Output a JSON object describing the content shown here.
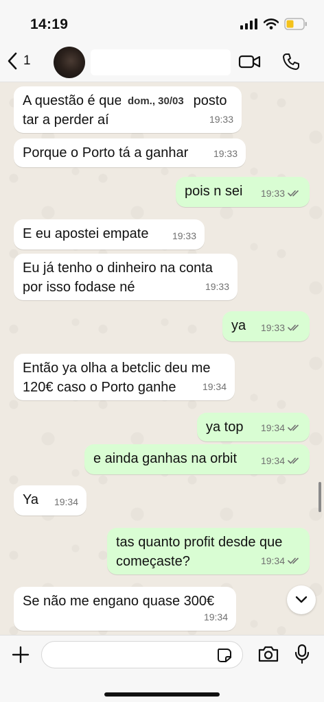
{
  "status_bar": {
    "time": "14:19"
  },
  "header": {
    "back_count": "1"
  },
  "date_label": "dom., 30/03",
  "messages": [
    {
      "dir": "in",
      "lines": [
        "A questão é que",
        "tar a perder aí"
      ],
      "line1_suffix": "posto",
      "time": "19:33"
    },
    {
      "dir": "in",
      "text": "Porque o Porto tá a ganhar",
      "time": "19:33"
    },
    {
      "dir": "out",
      "text": "pois n sei",
      "time": "19:33"
    },
    {
      "dir": "in",
      "text": "E eu apostei empate",
      "time": "19:33"
    },
    {
      "dir": "in",
      "lines": [
        "Eu já tenho o dinheiro na conta",
        "por isso fodase né"
      ],
      "time": "19:33"
    },
    {
      "dir": "out",
      "text": "ya",
      "time": "19:33"
    },
    {
      "dir": "in",
      "lines": [
        "Então ya olha a betclic deu me",
        "120€ caso o Porto ganhe"
      ],
      "time": "19:34"
    },
    {
      "dir": "out",
      "text": "ya top",
      "time": "19:34"
    },
    {
      "dir": "out",
      "text": "e ainda ganhas na orbit",
      "time": "19:34"
    },
    {
      "dir": "in",
      "text": "Ya",
      "time": "19:34"
    },
    {
      "dir": "out",
      "lines": [
        "tas quanto profit desde que",
        "começaste?"
      ],
      "time": "19:34"
    },
    {
      "dir": "in",
      "text": "Se não me engano quase 300€",
      "time": "19:34"
    }
  ],
  "colors": {
    "incoming": "#ffffff",
    "outgoing": "#d9fdd3",
    "chat_bg": "#efeae2",
    "read_ticks": "#707070"
  },
  "icons": [
    "chevron-left-icon",
    "video-call-icon",
    "phone-icon",
    "plus-icon",
    "sticker-icon",
    "camera-icon",
    "microphone-icon",
    "chevron-down-icon",
    "double-check-icon"
  ]
}
